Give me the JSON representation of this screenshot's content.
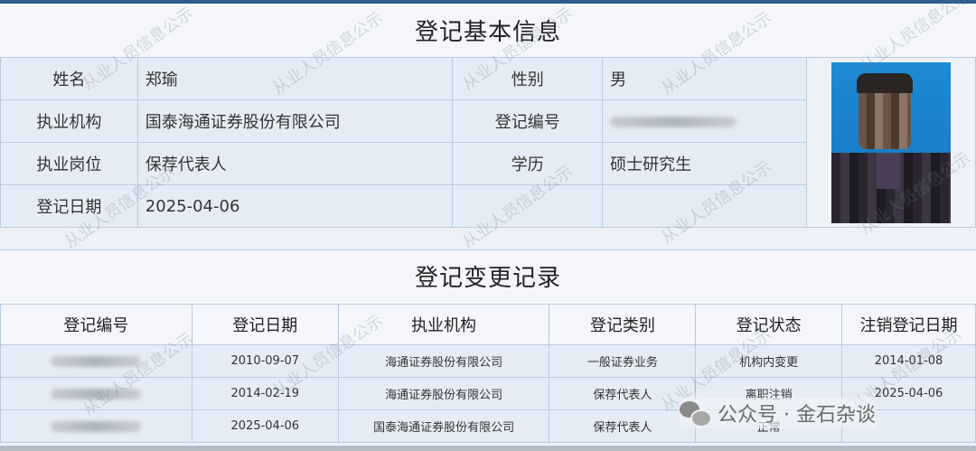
{
  "basic_info": {
    "title": "登记基本信息",
    "rows": [
      {
        "label1": "姓名",
        "value1": "郑瑜",
        "label2": "性别",
        "value2": "男"
      },
      {
        "label1": "执业机构",
        "value1": "国泰海通证券股份有限公司",
        "label2": "登记编号",
        "value2": ""
      },
      {
        "label1": "执业岗位",
        "value1": "保荐代表人",
        "label2": "学历",
        "value2": "硕士研究生"
      },
      {
        "label1": "登记日期",
        "value1": "2025-04-06",
        "label2": "",
        "value2": ""
      }
    ]
  },
  "change_records": {
    "title": "登记变更记录",
    "columns": [
      "登记编号",
      "登记日期",
      "执业机构",
      "登记类别",
      "登记状态",
      "注销登记日期"
    ],
    "rows": [
      {
        "id": "",
        "date": "2010-09-07",
        "org": "海通证券股份有限公司",
        "category": "一般证券业务",
        "status": "机构内变更",
        "cancel_date": "2014-01-08"
      },
      {
        "id": "",
        "date": "2014-02-19",
        "org": "海通证券股份有限公司",
        "category": "保荐代表人",
        "status": "离职注销",
        "cancel_date": "2025-04-06"
      },
      {
        "id": "",
        "date": "2025-04-06",
        "org": "国泰海通证券股份有限公司",
        "category": "保荐代表人",
        "status": "正常",
        "cancel_date": ""
      }
    ]
  },
  "watermark_text": "从业人员信息公示",
  "footer_brand": "公众号 · 金石杂谈",
  "colors": {
    "border": "#b9cbe0",
    "cell_bg": "#e6ecf5",
    "photo_bg": "#1a7fc8"
  }
}
